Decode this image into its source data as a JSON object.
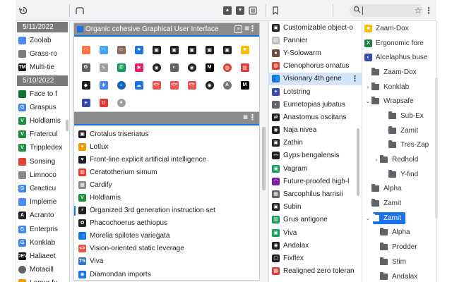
{
  "toolbar": {
    "history_icon": "history-icon",
    "tabs_icon": "tab-outline-icon",
    "bookmarks_icon": "bookmark-outline-icon",
    "search_icon": "search-icon",
    "star_icon": "star-icon",
    "more_icon": "more-vertical-icon",
    "separator": "|",
    "search_value": ""
  },
  "history": {
    "groups": [
      {
        "date": "5/11/2022",
        "items": [
          {
            "label": "Zoolab",
            "icon": "chat",
            "color": "#4c8bf5"
          },
          {
            "label": "Grass-ro",
            "icon": "pencil",
            "color": "#7a7a7a"
          },
          {
            "label": "Multi-tie",
            "icon": "TM",
            "color": "#111111"
          }
        ]
      },
      {
        "date": "5/10/2022",
        "items": [
          {
            "label": "Face to f",
            "icon": "stripes",
            "color": "#137333"
          },
          {
            "label": "Graspus",
            "icon": "G",
            "color": "#4285f4"
          },
          {
            "label": "Holdlamis",
            "icon": "V",
            "color": "#1e8e3e"
          },
          {
            "label": "Fratercul",
            "icon": "V",
            "color": "#1e8e3e"
          },
          {
            "label": "Trippledex",
            "icon": "V",
            "color": "#1e8e3e"
          },
          {
            "label": "Sonsing",
            "icon": "chrome",
            "color": "#db4437"
          },
          {
            "label": "Limnoco",
            "icon": "doc",
            "color": "#888888"
          },
          {
            "label": "Gracticu",
            "icon": "G",
            "color": "#4285f4"
          },
          {
            "label": "Impleme",
            "icon": "chat",
            "color": "#4c8bf5"
          },
          {
            "label": "Acranto",
            "icon": "A",
            "color": "#202124"
          },
          {
            "label": "Enterpris",
            "icon": "G",
            "color": "#4285f4"
          },
          {
            "label": "Konklab",
            "icon": "G",
            "color": "#4285f4"
          },
          {
            "label": "Haliaeet",
            "icon": "DEV",
            "color": "#000000"
          },
          {
            "label": "Motacill",
            "icon": "dot",
            "color": "#5f6368"
          },
          {
            "label": "Lemur fu",
            "icon": "heart",
            "color": "#f29900"
          }
        ]
      }
    ]
  },
  "windows": [
    {
      "title": "Organic cohesive Graphical User Interface",
      "icons": [
        {
          "glyph": "◠",
          "color": "#ff7043"
        },
        {
          "glyph": "◠",
          "color": "#42a5f5"
        },
        {
          "glyph": "☺",
          "color": "#8d6e63"
        },
        {
          "glyph": "⚑",
          "color": "#1a73e8"
        },
        {
          "glyph": "▣",
          "color": "#202124"
        },
        {
          "glyph": "▣",
          "color": "#202124"
        },
        {
          "glyph": "▣",
          "color": "#202124"
        },
        {
          "glyph": "▣",
          "color": "#202124"
        },
        {
          "glyph": "▣",
          "color": "#202124"
        },
        {
          "glyph": "■",
          "color": "#fbbc04"
        },
        {
          "glyph": "G",
          "color": "#5f6368"
        },
        {
          "glyph": "✎",
          "color": "#9e9e9e"
        },
        {
          "glyph": "@",
          "color": "#0f9d58"
        },
        {
          "glyph": "✱",
          "color": "#e91e63"
        },
        {
          "glyph": "◉",
          "color": "#202124"
        },
        {
          "glyph": "◐",
          "color": "#5f6368"
        },
        {
          "glyph": "◉",
          "color": "#202124"
        },
        {
          "glyph": "M",
          "color": "#000000"
        },
        {
          "glyph": "◍",
          "color": "#db4437"
        },
        {
          "glyph": "▥",
          "color": "#e53935"
        },
        {
          "glyph": "◆",
          "color": "#202124"
        },
        {
          "glyph": "✚",
          "color": "#4285f4"
        },
        {
          "glyph": "◒",
          "color": "#0a66c2"
        },
        {
          "glyph": "☁",
          "color": "#1a73e8"
        },
        {
          "glyph": "<>",
          "color": "#ef5350"
        },
        {
          "glyph": "<>",
          "color": "#ef5350"
        },
        {
          "glyph": "<>",
          "color": "#ef5350"
        },
        {
          "glyph": "◉",
          "color": "#202124"
        },
        {
          "glyph": "A",
          "color": "#757575"
        },
        {
          "glyph": "M",
          "color": "#000000"
        },
        {
          "glyph": "✦",
          "color": "#3949ab"
        },
        {
          "glyph": "♉",
          "color": "#e53935"
        },
        {
          "glyph": "●",
          "color": "#9e9e9e"
        }
      ]
    },
    {
      "title": "",
      "tabs": [
        {
          "label": "Crotalus triseriatus",
          "icon": "▣",
          "color": "#202124"
        },
        {
          "label": "Lotlux",
          "icon": "♥",
          "color": "#f29900"
        },
        {
          "label": "Front-line explicit artificial intelligence",
          "icon": "♥",
          "color": "#202124"
        },
        {
          "label": "Ceratotherium simum",
          "icon": "▥",
          "color": "#e53935"
        },
        {
          "label": "Cardify",
          "icon": "▦",
          "color": "#8a8a8a"
        },
        {
          "label": "Holdlamis",
          "icon": "V",
          "color": "#1e8e3e"
        },
        {
          "label": "Organized 3rd generation instruction set",
          "icon": "⚡",
          "color": "#202124",
          "active": true
        },
        {
          "label": "Phacochoerus aethiopus",
          "icon": "✿",
          "color": "#202124"
        },
        {
          "label": "Morelia spilotes variegata",
          "icon": "👥",
          "color": "#1a73e8"
        },
        {
          "label": "Vision-oriented static leverage",
          "icon": "<>",
          "color": "#ef5350"
        },
        {
          "label": "Viva",
          "icon": "TS",
          "color": "#3178c6"
        },
        {
          "label": "Diamondan imports",
          "icon": "◉",
          "color": "#1a73e8"
        }
      ]
    }
  ],
  "middle": {
    "items": [
      {
        "label": "Customizable object-o",
        "icon": "▣",
        "color": "#202124"
      },
      {
        "label": "Pannier",
        "icon": "▤",
        "color": "#bdbdbd"
      },
      {
        "label": "Y-Solowarm",
        "icon": "●",
        "color": "#6d4c41"
      },
      {
        "label": "Ctenophorus ornatus",
        "icon": "◍",
        "color": "#db4437"
      },
      {
        "label": "Visionary 4th gene",
        "icon": "👥",
        "color": "#1a73e8",
        "selected": true
      },
      {
        "label": "Lotstring",
        "icon": "✦",
        "color": "#3949ab"
      },
      {
        "label": "Eumetopias jubatus",
        "icon": "◐",
        "color": "#5f6368"
      },
      {
        "label": "Anastomus oscitans",
        "icon": "⇄",
        "color": "#202124"
      },
      {
        "label": "Naja nivea",
        "icon": "◉",
        "color": "#202124"
      },
      {
        "label": "Zathin",
        "icon": "▣",
        "color": "#202124"
      },
      {
        "label": "Gyps bengalensis",
        "icon": "—",
        "color": "#202124"
      },
      {
        "label": "Vagram",
        "icon": "▣",
        "color": "#0f9d58"
      },
      {
        "label": "Future-proofed high-l",
        "icon": "◠",
        "color": "#7b1fa2"
      },
      {
        "label": "Sarcophilus harrisii",
        "icon": "▦",
        "color": "#5f6368"
      },
      {
        "label": "Subin",
        "icon": "▣",
        "color": "#202124"
      },
      {
        "label": "Grus antigone",
        "icon": "▥",
        "color": "#0f9d58"
      },
      {
        "label": "Viva",
        "icon": "▣",
        "color": "#0f9d58"
      },
      {
        "label": "Andalax",
        "icon": "◉",
        "color": "#202124"
      },
      {
        "label": "Fixflex",
        "icon": "▢",
        "color": "#202124"
      },
      {
        "label": "Realigned zero toleran",
        "icon": "▦",
        "color": "#e53935"
      }
    ],
    "row_menu": "⋮"
  },
  "bookmarks": {
    "items": [
      {
        "label": "Zaam-Dox",
        "type": "link",
        "icon": "■",
        "color": "#fbbc04",
        "indent": 0
      },
      {
        "label": "Ergonomic fore",
        "type": "link",
        "icon": "X",
        "color": "#1e7e45",
        "indent": 0
      },
      {
        "label": "Alcelaphus buse",
        "type": "link",
        "icon": "◐",
        "color": "#3949ab",
        "indent": 0
      },
      {
        "label": "Zaam-Dox",
        "type": "folder",
        "indent": 0
      },
      {
        "label": "Konklab",
        "type": "folder",
        "arrow": "›",
        "indent": 0
      },
      {
        "label": "Wrapsafe",
        "type": "folder",
        "arrow": "⌄",
        "indent": 0
      },
      {
        "label": "Sub-Ex",
        "type": "folder",
        "indent": 2
      },
      {
        "label": "Zamit",
        "type": "folder",
        "indent": 2
      },
      {
        "label": "Tres-Zap",
        "type": "folder",
        "indent": 2
      },
      {
        "label": "Redhold",
        "type": "folder",
        "arrow": "›",
        "indent": 1
      },
      {
        "label": "Y-find",
        "type": "folder",
        "indent": 2
      },
      {
        "label": "Alpha",
        "type": "folder",
        "indent": 0
      },
      {
        "label": "Zamit",
        "type": "folder",
        "indent": 0
      },
      {
        "label": "Zamit",
        "type": "folder",
        "arrow": "⌄",
        "indent": 0,
        "selected": true
      },
      {
        "label": "Alpha",
        "type": "folder",
        "indent": 1
      },
      {
        "label": "Prodder",
        "type": "folder",
        "indent": 1
      },
      {
        "label": "Stim",
        "type": "folder",
        "indent": 1
      },
      {
        "label": "Andalax",
        "type": "folder",
        "indent": 1
      }
    ]
  },
  "colors": {
    "accent": "#1a73e8",
    "header_gray": "#8c8c8c",
    "date_gray": "#7b7b7b",
    "selected_row": "#d4e4fb"
  }
}
